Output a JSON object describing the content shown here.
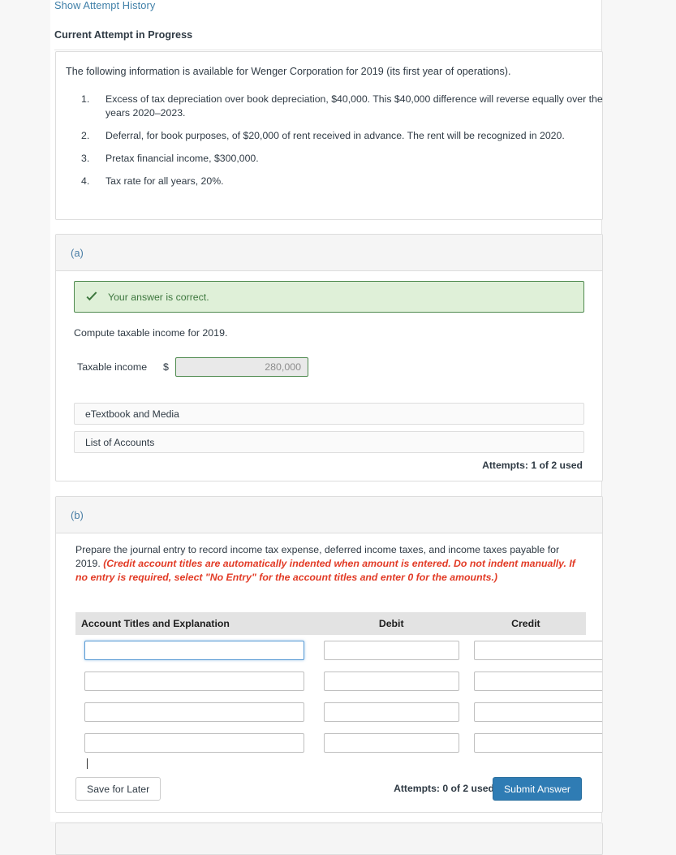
{
  "header": {
    "attempt_history_link": "Show Attempt History",
    "current_attempt": "Current Attempt in Progress"
  },
  "intro": {
    "lead": "The following information is available for Wenger Corporation for 2019 (its first year of operations).",
    "facts": [
      "Excess of tax depreciation over book depreciation, $40,000. This $40,000 difference will reverse equally over the years 2020–2023.",
      "Deferral, for book purposes, of $20,000 of rent received in advance. The rent will be recognized in 2020.",
      "Pretax financial income, $300,000.",
      "Tax rate for all years, 20%."
    ]
  },
  "part_a": {
    "letter": "(a)",
    "alert_text": "Your answer is correct.",
    "alert_icon": "check-icon",
    "alert_bg": "#dff0d8",
    "alert_border": "#4f8a4f",
    "prompt": "Compute taxable income for 2019.",
    "answer_label": "Taxable income",
    "currency_symbol": "$",
    "answer_value": "280,000",
    "etextbook_label": "eTextbook and Media",
    "list_accounts_label": "List of Accounts",
    "attempts": "Attempts: 1 of 2 used"
  },
  "part_b": {
    "letter": "(b)",
    "prompt_plain": "Prepare the journal entry to record income tax expense, deferred income taxes, and income taxes payable for 2019. ",
    "prompt_hint": "(Credit account titles are automatically indented when amount is entered. Do not indent manually. If no entry is required, select \"No Entry\" for the account titles and enter 0 for the amounts.)",
    "table": {
      "columns": [
        "Account Titles and Explanation",
        "Debit",
        "Credit"
      ],
      "rows": [
        {
          "account": "",
          "debit": "",
          "credit": ""
        },
        {
          "account": "",
          "debit": "",
          "credit": ""
        },
        {
          "account": "",
          "debit": "",
          "credit": ""
        },
        {
          "account": "",
          "debit": "",
          "credit": ""
        }
      ]
    },
    "save_label": "Save for Later",
    "attempts": "Attempts: 0 of 2 used",
    "submit_label": "Submit Answer",
    "submit_color": "#2f7cb4"
  }
}
